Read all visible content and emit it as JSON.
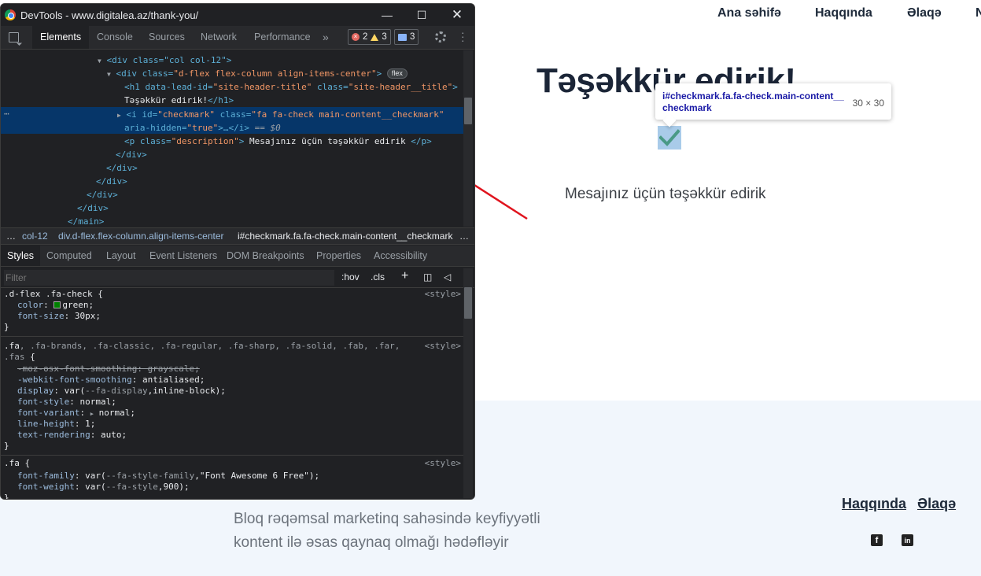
{
  "website": {
    "nav": [
      "Ana səhifə",
      "Haqqında",
      "Əlaqə",
      "N"
    ],
    "title": "Təşəkkür edirik!",
    "description": "Mesajınız üçün təşəkkür edirik",
    "tooltip": {
      "selector": "i#checkmark.fa.fa-check.main-content__checkmark",
      "size": "30 × 30"
    },
    "footer": {
      "tagline": "Bloq rəqəmsal marketinq sahəsində keyfiyyətli kontent ilə əsas qaynaq olmağı hədəfləyir",
      "links": [
        "Haqqında",
        "Əlaqə"
      ],
      "social": [
        "facebook-icon",
        "linkedin-icon"
      ]
    }
  },
  "devtools": {
    "title": "DevTools - www.digitalea.az/thank-you/",
    "tabs": [
      "Elements",
      "Console",
      "Sources",
      "Network",
      "Performance"
    ],
    "more": "»",
    "errors": "2",
    "warnings": "3",
    "messages": "3",
    "dom": {
      "l0": "<div class=\"col col-12\">",
      "l1_tag": "<div class=",
      "l1_val": "\"d-flex flex-column align-items-center\"",
      "l1_badge": "flex",
      "l2_a": "<h1 data-lead-id=",
      "l2_av": "\"site-header-title\"",
      "l2_b": " class=",
      "l2_bv": "\"site-header__title\"",
      "l3": "Təşəkkür edirik!",
      "l3_close": "</h1>",
      "l4_a": "<i id=",
      "l4_av": "\"checkmark\"",
      "l4_b": " class=",
      "l4_bv": "\"fa fa-check main-content__checkmark\"",
      "l5_a": "aria-hidden=",
      "l5_av": "\"true\"",
      "l5_b": ">…</i>",
      "l5_eq": " == $0",
      "l6_a": "<p class=",
      "l6_av": "\"description\"",
      "l6_txt": " Mesajınız üçün təşəkkür edirik ",
      "l6_close": "</p>",
      "closers": [
        "</div>",
        "</div>",
        "</div>",
        "</div>",
        "</div>",
        "</main>"
      ]
    },
    "breadcrumbs": [
      "…",
      "col-12",
      "div.d-flex.flex-column.align-items-center",
      "i#checkmark.fa.fa-check.main-content__checkmark",
      "…"
    ],
    "subtabs": [
      "Styles",
      "Computed",
      "Layout",
      "Event Listeners",
      "DOM Breakpoints",
      "Properties",
      "Accessibility"
    ],
    "filter_placeholder": "Filter",
    "hov": ":hov",
    "cls": ".cls",
    "styles": {
      "r1_sel": ".d-flex .fa-check {",
      "r1_src": "<style>",
      "r1_p1n": "color",
      "r1_p1v": "green;",
      "r1_p2n": "font-size",
      "r1_p2v": "30px;",
      "r2_sel_a": ".fa",
      "r2_sel_b": ", .fa-brands, .fa-classic, .fa-regular, .fa-sharp, .fa-solid, .fab, .far,",
      "r2_sel_c": ".fas",
      "r2_src": "<style>",
      "r2_p1": "-moz-osx-font-smoothing: grayscale;",
      "r2_p2n": "-webkit-font-smoothing",
      "r2_p2v": "antialiased;",
      "r2_p3n": "display",
      "r2_p3v": "var(",
      "r2_p3var": "--fa-display",
      "r2_p3rest": ",inline-block);",
      "r2_p4n": "font-style",
      "r2_p4v": "normal;",
      "r2_p5n": "font-variant",
      "r2_p5v": "normal;",
      "r2_p6n": "line-height",
      "r2_p6v": "1;",
      "r2_p7n": "text-rendering",
      "r2_p7v": "auto;",
      "r3_sel": ".fa {",
      "r3_src": "<style>",
      "r3_p1n": "font-family",
      "r3_p1v": "var(",
      "r3_p1var": "--fa-style-family",
      "r3_p1rest": ",\"Font Awesome 6 Free\");",
      "r3_p2n": "font-weight",
      "r3_p2v": "var(",
      "r3_p2var": "--fa-style",
      "r3_p2rest": ",900);"
    }
  }
}
